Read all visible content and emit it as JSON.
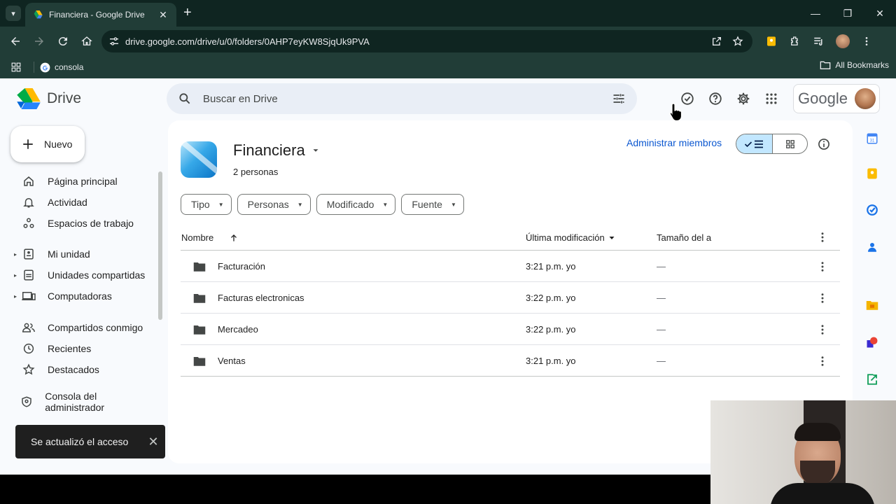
{
  "browser": {
    "tab_title": "Financiera - Google Drive",
    "url": "drive.google.com/drive/u/0/folders/0AHP7eyKW8SjqUk9PVA",
    "bookmark": "consola",
    "all_bookmarks": "All Bookmarks"
  },
  "drive": {
    "brand": "Drive",
    "search_placeholder": "Buscar en Drive",
    "google_word": "Google",
    "new_button": "Nuevo",
    "nav": [
      {
        "label": "Página principal"
      },
      {
        "label": "Actividad"
      },
      {
        "label": "Espacios de trabajo"
      },
      {
        "label": "Mi unidad"
      },
      {
        "label": "Unidades compartidas"
      },
      {
        "label": "Computadoras"
      },
      {
        "label": "Compartidos conmigo"
      },
      {
        "label": "Recientes"
      },
      {
        "label": "Destacados"
      },
      {
        "label": "Consola del administrador"
      }
    ],
    "snackbar": "Se actualizó el acceso",
    "folder": {
      "title": "Financiera",
      "subtitle": "2 personas",
      "manage_members": "Administrar miembros"
    },
    "filters": [
      "Tipo",
      "Personas",
      "Modificado",
      "Fuente"
    ],
    "table": {
      "col_name": "Nombre",
      "col_modified": "Última modificación",
      "col_size": "Tamaño del a",
      "rows": [
        {
          "name": "Facturación",
          "modified": "3:21 p.m. yo",
          "size": "—"
        },
        {
          "name": "Facturas electronicas",
          "modified": "3:22 p.m. yo",
          "size": "—"
        },
        {
          "name": "Mercadeo",
          "modified": "3:22 p.m. yo",
          "size": "—"
        },
        {
          "name": "Ventas",
          "modified": "3:21 p.m. yo",
          "size": "—"
        }
      ]
    }
  },
  "colors": {
    "accent": "#0b57d0",
    "chrome_bg": "#213d37",
    "tabstrip_bg": "#0f2521",
    "view_toggle_active": "#c2e7ff"
  }
}
